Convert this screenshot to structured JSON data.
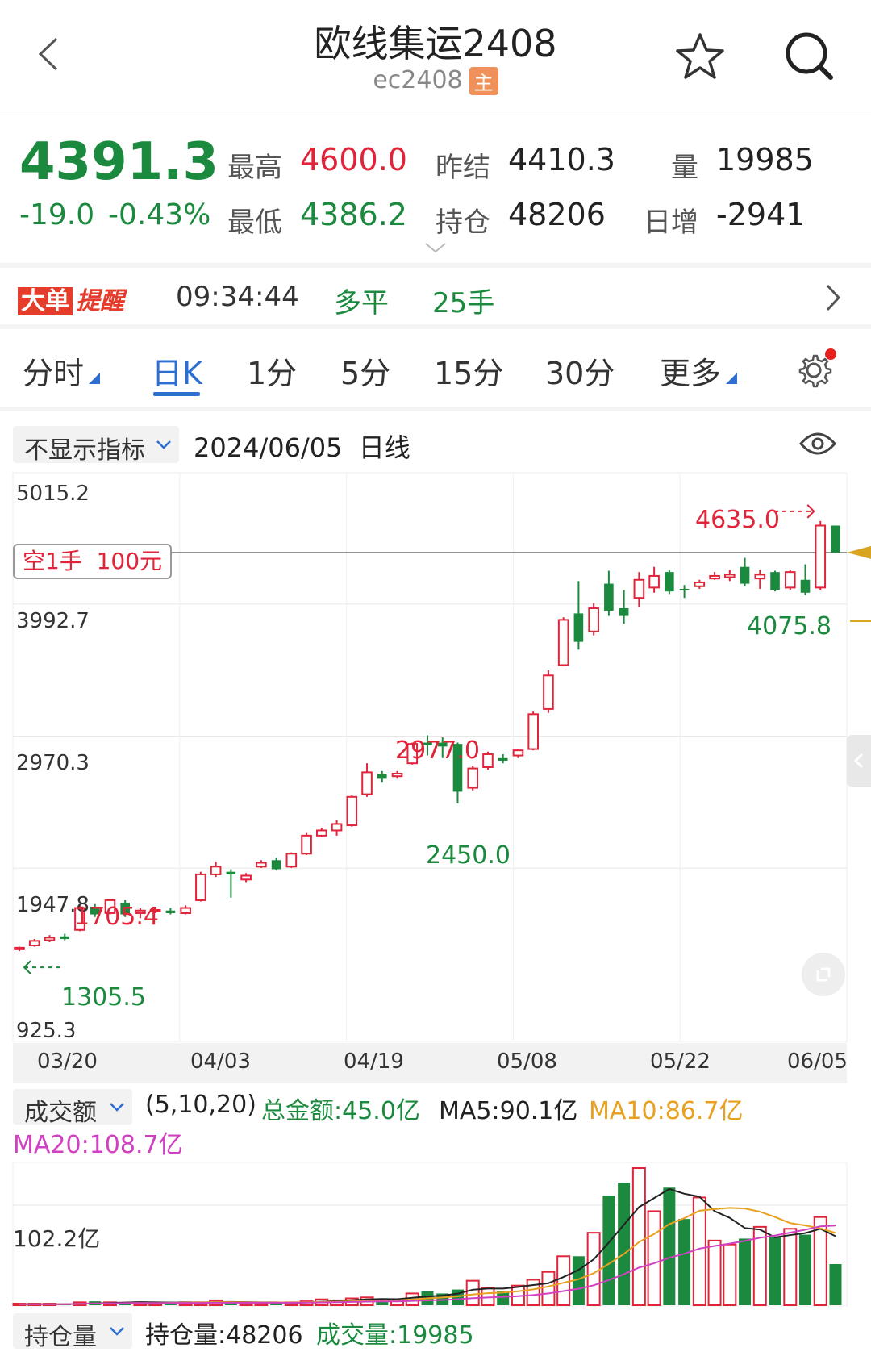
{
  "header": {
    "title": "欧线集运2408",
    "code": "ec2408",
    "badge": "主"
  },
  "quote": {
    "price": "4391.3",
    "change": "-19.0",
    "change_pct": "-0.43%",
    "high_label": "最高",
    "high": "4600.0",
    "low_label": "最低",
    "low": "4386.2",
    "prev_settle_label": "昨结",
    "prev_settle": "4410.3",
    "open_interest_label": "持仓",
    "open_interest": "48206",
    "volume_label": "量",
    "volume": "19985",
    "daily_inc_label": "日增",
    "daily_inc": "-2941"
  },
  "alert": {
    "tag_a": "大单",
    "tag_b": "提醒",
    "time": "09:34:44",
    "type": "多平",
    "size": "25手"
  },
  "tabs": [
    {
      "label": "分时"
    },
    {
      "label": "日K"
    },
    {
      "label": "1分"
    },
    {
      "label": "5分"
    },
    {
      "label": "15分"
    },
    {
      "label": "30分"
    },
    {
      "label": "更多"
    }
  ],
  "toolbar": {
    "indicator_select": "不显示指标",
    "date_info": "2024/06/05  日线"
  },
  "position_tag": "空1手  100元",
  "chart_data": {
    "type": "candlestick",
    "y_ticks": [
      "5015.2",
      "3992.7",
      "2970.3",
      "1947.8",
      "925.3"
    ],
    "ylim": [
      925.3,
      5015.2
    ],
    "x_ticks": [
      "03/20",
      "04/03",
      "04/19",
      "05/08",
      "05/22",
      "06/05"
    ],
    "annotations": {
      "max_label": "4635.0",
      "min_label": "1305.5",
      "labels": [
        "1705.4",
        "2977.0",
        "2450.0",
        "4075.8"
      ]
    },
    "candles": [
      [
        1320,
        1332,
        1305.5,
        1340
      ],
      [
        1350,
        1385,
        1340,
        1400
      ],
      [
        1390,
        1410,
        1375,
        1430
      ],
      [
        1420,
        1400,
        1390,
        1440
      ],
      [
        1470,
        1640,
        1460,
        1660
      ],
      [
        1650,
        1590,
        1570,
        1670
      ],
      [
        1600,
        1700,
        1590,
        1705.4
      ],
      [
        1680,
        1590,
        1570,
        1700
      ],
      [
        1600,
        1620,
        1560,
        1640
      ],
      [
        1615,
        1625,
        1600,
        1650
      ],
      [
        1620,
        1600,
        1590,
        1640
      ],
      [
        1600,
        1640,
        1590,
        1660
      ],
      [
        1700,
        1900,
        1690,
        1920
      ],
      [
        1900,
        1960,
        1880,
        2000
      ],
      [
        1920,
        1900,
        1720,
        1940
      ],
      [
        1860,
        1890,
        1840,
        1910
      ],
      [
        1960,
        1990,
        1950,
        2010
      ],
      [
        2010,
        1940,
        1930,
        2030
      ],
      [
        1960,
        2060,
        1950,
        2070
      ],
      [
        2060,
        2200,
        2050,
        2220
      ],
      [
        2200,
        2240,
        2190,
        2260
      ],
      [
        2240,
        2290,
        2200,
        2320
      ],
      [
        2280,
        2500,
        2270,
        2510
      ],
      [
        2520,
        2690,
        2500,
        2760
      ],
      [
        2680,
        2640,
        2610,
        2700
      ],
      [
        2660,
        2680,
        2640,
        2700
      ],
      [
        2760,
        2910,
        2750,
        2920
      ],
      [
        2920,
        2900,
        2820,
        2977
      ],
      [
        2920,
        2890,
        2800,
        2960
      ],
      [
        2910,
        2540,
        2450,
        2920
      ],
      [
        2570,
        2720,
        2550,
        2740
      ],
      [
        2730,
        2830,
        2710,
        2850
      ],
      [
        2800,
        2780,
        2760,
        2830
      ],
      [
        2820,
        2860,
        2800,
        2870
      ],
      [
        2870,
        3140,
        2860,
        3160
      ],
      [
        3180,
        3440,
        3150,
        3480
      ],
      [
        3520,
        3870,
        3510,
        3890
      ],
      [
        3920,
        3700,
        3640,
        4170
      ],
      [
        3780,
        3960,
        3750,
        4000
      ],
      [
        4150,
        3940,
        3900,
        4250
      ],
      [
        3960,
        3900,
        3840,
        4100
      ],
      [
        4040,
        4180,
        3970,
        4240
      ],
      [
        4120,
        4210,
        4080,
        4280
      ],
      [
        4240,
        4090,
        4070,
        4260
      ],
      [
        4110,
        4100,
        4040,
        4140
      ],
      [
        4130,
        4160,
        4110,
        4180
      ],
      [
        4190,
        4210,
        4180,
        4240
      ],
      [
        4200,
        4220,
        4170,
        4260
      ],
      [
        4280,
        4150,
        4130,
        4350
      ],
      [
        4190,
        4220,
        4110,
        4260
      ],
      [
        4240,
        4100,
        4090,
        4250
      ],
      [
        4120,
        4240,
        4100,
        4260
      ],
      [
        4180,
        4080,
        4060,
        4300
      ],
      [
        4120,
        4600,
        4100,
        4635
      ],
      [
        4600,
        4391.3,
        4386.2,
        4600
      ]
    ]
  },
  "volume_panel": {
    "select": "成交额",
    "params": "(5,10,20)",
    "total": "总金额:45.0亿",
    "ma5": "MA5:90.1亿",
    "ma10": "MA10:86.7亿",
    "ma20": "MA20:108.7亿",
    "ref_level": "102.2亿",
    "bars": [
      1,
      1,
      1,
      1,
      3,
      4,
      3,
      3,
      3,
      2,
      3,
      3,
      3,
      5,
      3,
      2,
      2,
      3,
      3,
      4,
      6,
      5,
      7,
      8,
      6,
      5,
      12,
      14,
      12,
      16,
      25,
      18,
      14,
      20,
      26,
      34,
      50,
      50,
      74,
      112,
      125,
      140,
      96,
      120,
      88,
      110,
      66,
      62,
      68,
      80,
      70,
      78,
      72,
      90,
      42
    ]
  },
  "oi_panel": {
    "select": "持仓量",
    "oi": "持仓量:48206",
    "vol": "成交量:19985"
  },
  "colors": {
    "up": "#e0243a",
    "down": "#1b8a3e",
    "accent": "#2c6fd1",
    "ma5": "#222222",
    "ma10": "#e8a020",
    "ma20": "#d040c0"
  }
}
